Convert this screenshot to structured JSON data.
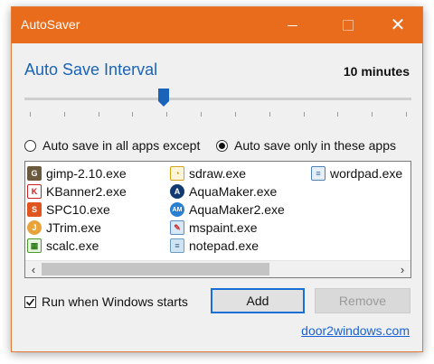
{
  "window": {
    "title": "AutoSaver",
    "accent_color": "#e96b1c",
    "minimize_icon": "minimize-icon",
    "maximize_icon": "maximize-icon",
    "close_icon": "close-icon"
  },
  "interval": {
    "heading": "Auto Save Interval",
    "value_text": "10 minutes",
    "slider_fraction": 0.36,
    "tick_count": 12
  },
  "mode": {
    "option_except": "Auto save in all apps except",
    "option_only": "Auto save only in these apps",
    "selected": "only"
  },
  "apps": [
    {
      "name": "gimp-2.10.exe",
      "icon": "gimp-icon"
    },
    {
      "name": "KBanner2.exe",
      "icon": "kbanner-icon"
    },
    {
      "name": "SPC10.exe",
      "icon": "spc-icon"
    },
    {
      "name": "JTrim.exe",
      "icon": "jtrim-icon"
    },
    {
      "name": "scalc.exe",
      "icon": "calc-icon"
    },
    {
      "name": "sdraw.exe",
      "icon": "draw-icon"
    },
    {
      "name": "AquaMaker.exe",
      "icon": "aquamaker-icon"
    },
    {
      "name": "AquaMaker2.exe",
      "icon": "aquamaker2-icon"
    },
    {
      "name": "mspaint.exe",
      "icon": "paint-icon"
    },
    {
      "name": "notepad.exe",
      "icon": "notepad-icon"
    },
    {
      "name": "wordpad.exe",
      "icon": "wordpad-icon"
    }
  ],
  "options": {
    "run_on_startup_label": "Run when Windows starts",
    "run_on_startup_checked": true
  },
  "buttons": {
    "add": "Add",
    "remove": "Remove"
  },
  "footer": {
    "link": "door2windows.com"
  }
}
